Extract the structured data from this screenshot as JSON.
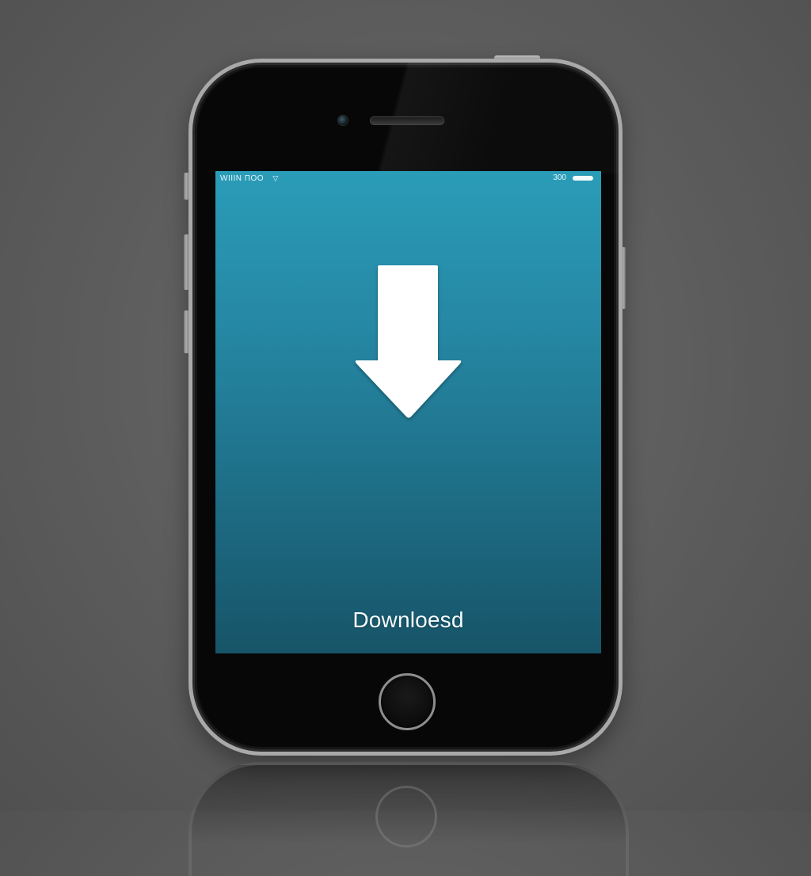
{
  "status_bar": {
    "carrier": "WIIIN ΠΟΟ",
    "wifi_icon": "wifi-icon",
    "battery_text": "300",
    "battery_icon": "battery-icon"
  },
  "main": {
    "icon": "download-arrow-icon",
    "label": "Downloesd"
  },
  "colors": {
    "screen_top": "#2a9cb8",
    "screen_bottom": "#175468",
    "background": "#5c5c5c",
    "phone_body": "#070707"
  }
}
